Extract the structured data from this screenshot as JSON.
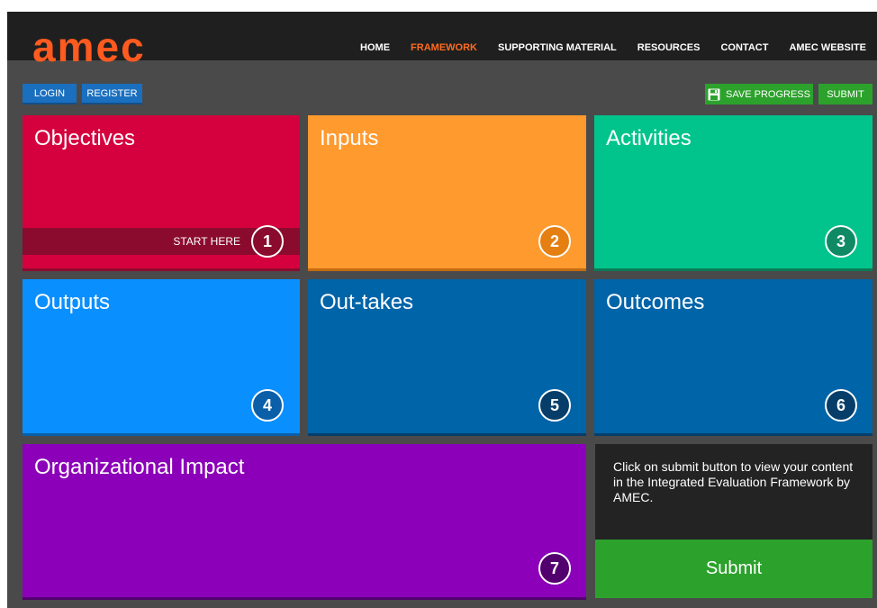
{
  "header": {
    "logo_text": "amec",
    "nav": [
      {
        "label": "HOME"
      },
      {
        "label": "FRAMEWORK"
      },
      {
        "label": "SUPPORTING MATERIAL"
      },
      {
        "label": "RESOURCES"
      },
      {
        "label": "CONTACT"
      },
      {
        "label": "AMEC WEBSITE"
      }
    ],
    "active_nav": "FRAMEWORK"
  },
  "actions": {
    "login": "LOGIN",
    "register": "REGISTER",
    "save_progress": "SAVE PROGRESS",
    "submit": "SUBMIT"
  },
  "tiles": [
    {
      "title": "Objectives",
      "number": "1",
      "color": "#d5003e",
      "circle_bg": "#8b0b2e",
      "start_here": "START HERE"
    },
    {
      "title": "Inputs",
      "number": "2",
      "color": "#ff9a2f",
      "circle_bg": "#e57f12"
    },
    {
      "title": "Activities",
      "number": "3",
      "color": "#00c48c",
      "circle_bg": "#0f8a64"
    },
    {
      "title": "Outputs",
      "number": "4",
      "color": "#0a8fff",
      "circle_bg": "#0a5fa8"
    },
    {
      "title": "Out-takes",
      "number": "5",
      "color": "#0064a8",
      "circle_bg": "#063e69"
    },
    {
      "title": "Outcomes",
      "number": "6",
      "color": "#0064a8",
      "circle_bg": "#063e69"
    },
    {
      "title": "Organizational Impact",
      "number": "7",
      "color": "#8b00b8",
      "circle_bg": "#52006e"
    }
  ],
  "info": {
    "text": "Click on submit button to view your content in the Integrated Evaluation Framework by AMEC.",
    "submit_label": "Submit"
  }
}
